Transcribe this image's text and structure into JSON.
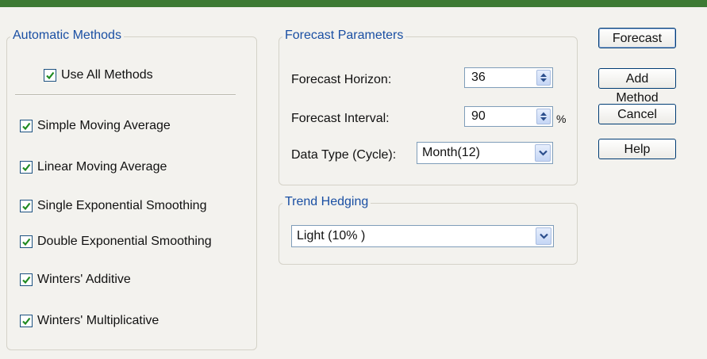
{
  "automatic_methods": {
    "legend": "Automatic Methods",
    "use_all": {
      "label": "Use All Methods",
      "checked": true
    },
    "methods": [
      {
        "label": "Simple Moving Average",
        "checked": true
      },
      {
        "label": "Linear Moving Average",
        "checked": true
      },
      {
        "label": "Single Exponential Smoothing",
        "checked": true
      },
      {
        "label": "Double Exponential Smoothing",
        "checked": true
      },
      {
        "label": "Winters' Additive",
        "checked": true
      },
      {
        "label": "Winters' Multiplicative",
        "checked": true
      }
    ]
  },
  "forecast_parameters": {
    "legend": "Forecast Parameters",
    "horizon_label": "Forecast Horizon:",
    "horizon_value": "36",
    "interval_label": "Forecast Interval:",
    "interval_value": "90",
    "interval_unit": "%",
    "data_type_label": "Data Type (Cycle):",
    "data_type_value": "Month(12)"
  },
  "trend_hedging": {
    "legend": "Trend Hedging",
    "value": "Light (10% )"
  },
  "buttons": {
    "forecast": "Forecast",
    "add_method": "Add Method",
    "cancel": "Cancel",
    "help": "Help"
  },
  "colors": {
    "title_bar": "#3d7a34",
    "legend_text": "#1a4fa3",
    "checkmark": "#1f8a1f"
  }
}
